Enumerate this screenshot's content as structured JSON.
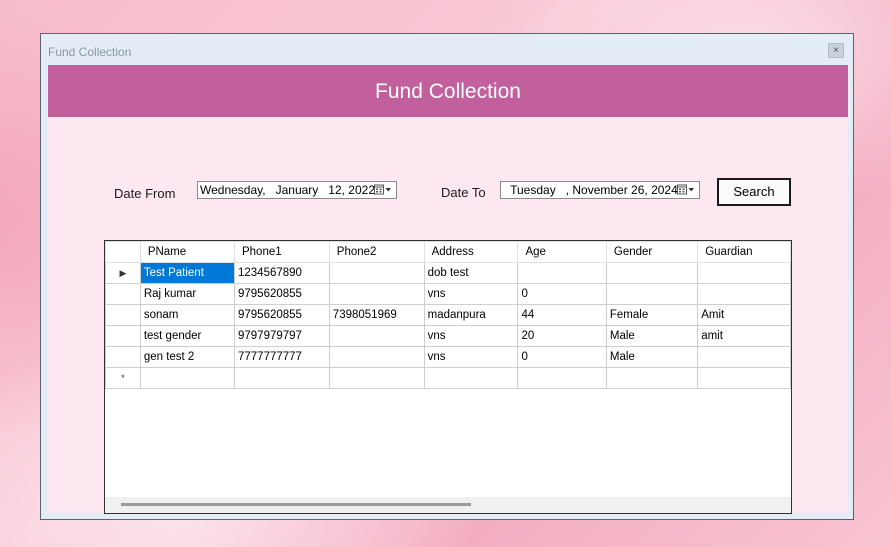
{
  "window": {
    "title": "Fund Collection",
    "close_label": "×"
  },
  "header": {
    "title": "Fund Collection"
  },
  "filters": {
    "date_from_label": "Date From",
    "date_from_value": "Wednesday,   January   12, 2022",
    "date_to_label": "Date To",
    "date_to_value": " Tuesday   , November 26, 2024",
    "search_label": "Search"
  },
  "grid": {
    "columns": [
      "PName",
      "Phone1",
      "Phone2",
      "Address",
      "Age",
      "Gender",
      "Guardian"
    ],
    "rows": [
      {
        "indicator": "▶",
        "cells": [
          "Test Patient",
          "1234567890",
          "",
          "dob test",
          "",
          "",
          ""
        ]
      },
      {
        "indicator": "",
        "cells": [
          "Raj kumar",
          "9795620855",
          "",
          "vns",
          "0",
          "",
          ""
        ]
      },
      {
        "indicator": "",
        "cells": [
          "sonam",
          "9795620855",
          "7398051969",
          "madanpura",
          "44",
          "Female",
          "Amit"
        ]
      },
      {
        "indicator": "",
        "cells": [
          "test gender",
          "9797979797",
          "",
          "vns",
          "20",
          "Male",
          "amit"
        ]
      },
      {
        "indicator": "",
        "cells": [
          "gen test 2",
          "7777777777",
          "",
          "vns",
          "0",
          "Male",
          ""
        ]
      },
      {
        "indicator": "*",
        "cells": [
          "",
          "",
          "",
          "",
          "",
          "",
          ""
        ]
      }
    ]
  },
  "colors": {
    "header_bg": "#c1609d",
    "client_bg": "#fde8f1",
    "selection": "#0078d7"
  }
}
